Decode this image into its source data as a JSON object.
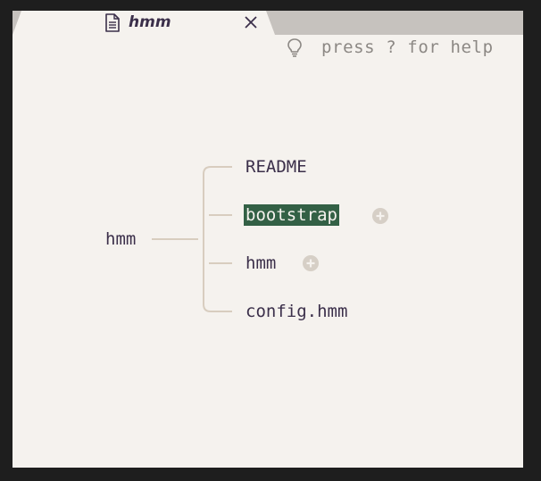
{
  "tab": {
    "title": "hmm"
  },
  "help": {
    "text": "press ? for help"
  },
  "map": {
    "root": "hmm",
    "children": [
      {
        "label": "README",
        "selected": false,
        "has_children": false
      },
      {
        "label": "bootstrap",
        "selected": true,
        "has_children": true
      },
      {
        "label": "hmm",
        "selected": false,
        "has_children": true
      },
      {
        "label": "config.hmm",
        "selected": false,
        "has_children": false
      }
    ]
  },
  "colors": {
    "tabbar": "#c6c2be",
    "canvas": "#f5f2ee",
    "text": "#3b2f4a",
    "selection": "#336045",
    "connector": "#d8cdbf",
    "add_icon": "#d6cfc6",
    "hint_text": "#8c8884"
  }
}
